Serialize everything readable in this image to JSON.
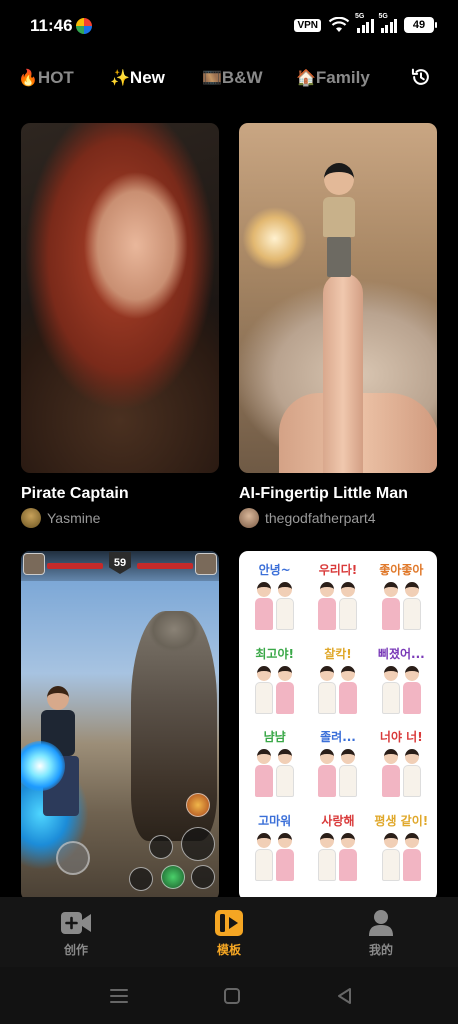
{
  "status_bar": {
    "time": "11:46",
    "vpn": "VPN",
    "network_1": "5G",
    "network_2": "5G",
    "battery": "49"
  },
  "tabs": [
    {
      "emoji": "🔥",
      "label": "HOT",
      "active": false
    },
    {
      "emoji": "✨",
      "label": "New",
      "active": true
    },
    {
      "emoji": "🎞️",
      "label": "B&W",
      "active": false
    },
    {
      "emoji": "🏠",
      "label": "Family",
      "active": false
    }
  ],
  "history_icon": "history-clock-icon",
  "cards": [
    {
      "title": "Pirate Captain",
      "author": "Yasmine"
    },
    {
      "title": "AI-Fingertip Little Man",
      "author": "thegodfatherpart4"
    },
    {
      "title": "",
      "author": ""
    },
    {
      "title": "",
      "author": ""
    }
  ],
  "game_hud": {
    "timer": "59"
  },
  "stickers": [
    {
      "text": "안녕~",
      "color": "#3b6fd8"
    },
    {
      "text": "우리다!",
      "color": "#d93a3a"
    },
    {
      "text": "좋아좋아",
      "color": "#e0792b"
    },
    {
      "text": "최고야!",
      "color": "#3aa848"
    },
    {
      "text": "찰칵!",
      "color": "#e0a82b"
    },
    {
      "text": "삐졌어...",
      "color": "#7a3ab8"
    },
    {
      "text": "냠냠",
      "color": "#3aa848"
    },
    {
      "text": "졸려...",
      "color": "#3b6fd8"
    },
    {
      "text": "너야 너!",
      "color": "#d93a3a"
    },
    {
      "text": "고마워",
      "color": "#3b6fd8"
    },
    {
      "text": "사랑해",
      "color": "#d93a3a"
    },
    {
      "text": "평생 같이!",
      "color": "#e0a82b"
    }
  ],
  "bottom_nav": [
    {
      "label": "创作",
      "icon": "create-video-icon",
      "active": false
    },
    {
      "label": "模板",
      "icon": "template-icon",
      "active": true
    },
    {
      "label": "我的",
      "icon": "profile-icon",
      "active": false
    }
  ],
  "accent_color": "#f5a623"
}
